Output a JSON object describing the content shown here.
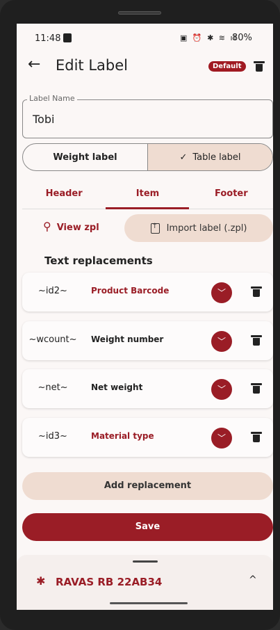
{
  "status_bar": {
    "time": "11:48",
    "battery": "80%"
  },
  "app_bar": {
    "back_icon": "←",
    "title": "Edit Label",
    "badge": "Default"
  },
  "label_name": {
    "legend": "Label Name",
    "value": "Tobi"
  },
  "label_type": {
    "left": "Weight label",
    "right": "Table label",
    "checkmark": "✓"
  },
  "tabs": [
    "Header",
    "Item",
    "Footer"
  ],
  "actions": {
    "view_zpl": "View zpl",
    "import_label": "Import label (.zpl)"
  },
  "section_title": "Text replacements",
  "replacements": [
    {
      "code": "~id2~",
      "description": "Product Barcode",
      "accent": true
    },
    {
      "code": "~wcount~",
      "description": "Weight number",
      "accent": false
    },
    {
      "code": "~net~",
      "description": "Net weight",
      "accent": false
    },
    {
      "code": "~id3~",
      "description": "Material type",
      "accent": true
    }
  ],
  "add_replacement_label": "Add replacement",
  "save_label": "Save",
  "device_sheet": {
    "device_name": "RAVAS RB 22AB34",
    "chevron": "^"
  },
  "colors": {
    "accent": "#9a1d26",
    "tonal": "#efdcd1",
    "background": "#fbf7f6"
  }
}
